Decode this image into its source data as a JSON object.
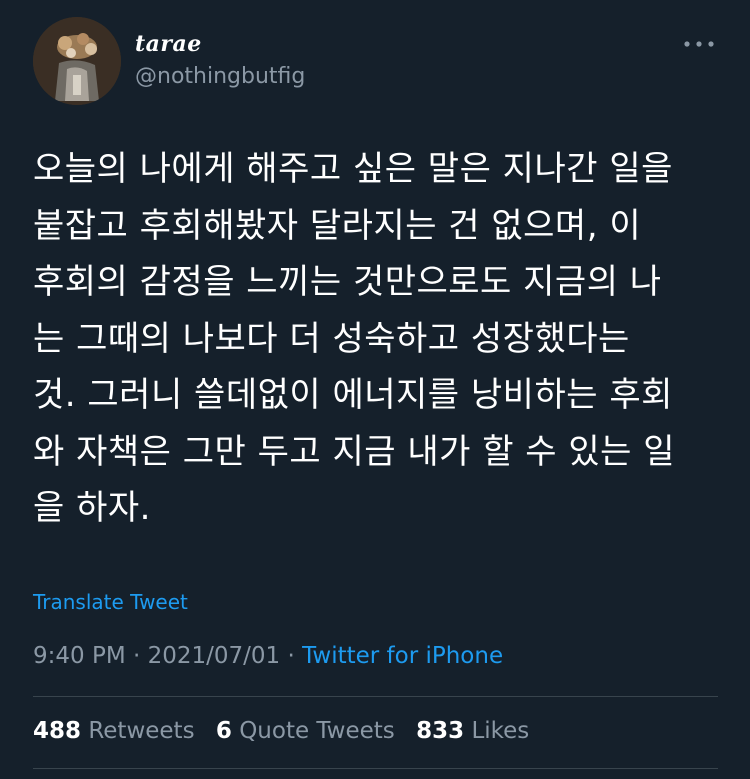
{
  "author": {
    "display_name": "tarae",
    "handle": "@nothingbutfig"
  },
  "tweet": {
    "text": "오늘의 나에게 해주고 싶은 말은 지나간 일을\n붙잡고 후회해봤자 달라지는 건 없으며, 이\n후회의 감정을 느끼는 것만으로도 지금의 나\n는 그때의 나보다 더 성숙하고 성장했다는\n것. 그러니 쓸데없이 에너지를 낭비하는 후회\n와 자책은 그만 두고 지금 내가 할 수 있는 일\n을 하자.",
    "translate_label": "Translate Tweet",
    "time": "9:40 PM",
    "separator": "·",
    "date": "2021/07/01",
    "source": "Twitter for iPhone"
  },
  "stats": {
    "retweets_count": "488",
    "retweets_label": "Retweets",
    "quote_count": "6",
    "quote_label": "Quote Tweets",
    "likes_count": "833",
    "likes_label": "Likes"
  },
  "icons": {
    "more": "more-horizontal-icon"
  },
  "colors": {
    "background": "#15202b",
    "link": "#1d9bf0",
    "secondary_text": "#8b98a5",
    "divider": "#38444d"
  }
}
